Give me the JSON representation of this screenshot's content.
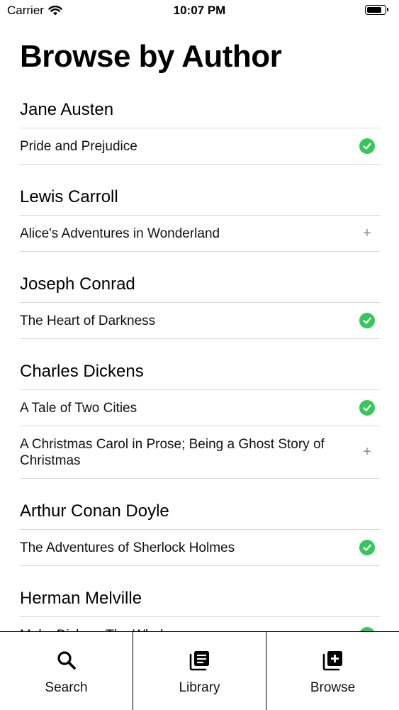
{
  "status_bar": {
    "carrier": "Carrier",
    "time": "10:07 PM",
    "battery_level": 0.85
  },
  "page": {
    "title": "Browse by Author"
  },
  "authors": [
    {
      "name": "Jane Austen",
      "books": [
        {
          "title": "Pride and Prejudice",
          "status": "added"
        }
      ]
    },
    {
      "name": "Lewis Carroll",
      "books": [
        {
          "title": "Alice's Adventures in Wonderland",
          "status": "add"
        }
      ]
    },
    {
      "name": "Joseph Conrad",
      "books": [
        {
          "title": "The Heart of Darkness",
          "status": "added"
        }
      ]
    },
    {
      "name": "Charles Dickens",
      "books": [
        {
          "title": "A Tale of Two Cities",
          "status": "added"
        },
        {
          "title": "A Christmas Carol in Prose; Being a Ghost Story of Christmas",
          "status": "add"
        }
      ]
    },
    {
      "name": "Arthur Conan Doyle",
      "books": [
        {
          "title": "The Adventures of Sherlock Holmes",
          "status": "added"
        }
      ]
    },
    {
      "name": "Herman Melville",
      "books": [
        {
          "title": "Moby Dick; or The Whale",
          "status": "added"
        }
      ]
    }
  ],
  "tab_bar": {
    "tabs": [
      {
        "label": "Search",
        "icon": "search-icon"
      },
      {
        "label": "Library",
        "icon": "library-icon"
      },
      {
        "label": "Browse",
        "icon": "browse-icon"
      }
    ]
  },
  "colors": {
    "added": "#34c759",
    "add": "#8e8e93"
  }
}
